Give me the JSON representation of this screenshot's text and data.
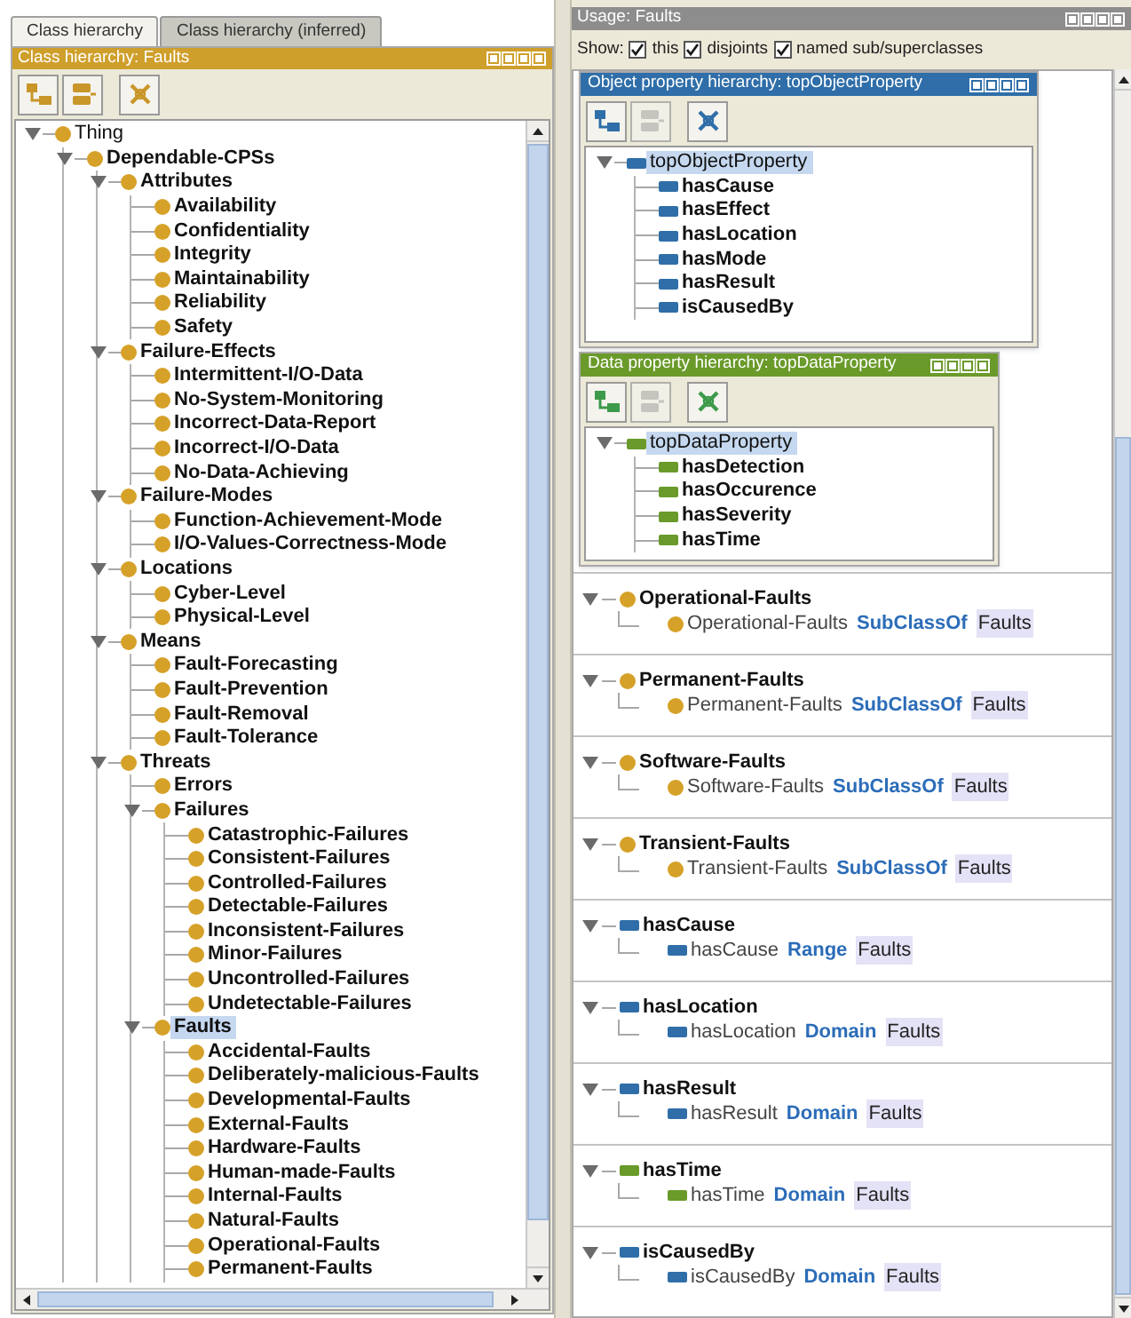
{
  "tabs": [
    {
      "label": "Class hierarchy",
      "selected": true
    },
    {
      "label": "Class hierarchy (inferred)",
      "selected": false
    }
  ],
  "class_hierarchy": {
    "title": "Class hierarchy: Faults",
    "toolbar": [
      {
        "kind": "add-sub",
        "disabled": false
      },
      {
        "kind": "add-sibling",
        "disabled": false
      },
      {
        "kind": "delete",
        "disabled": false
      }
    ],
    "tree": [
      {
        "label": "Thing",
        "expanded": true,
        "selected": false,
        "children": [
          {
            "label": "Dependable-CPSs",
            "expanded": true,
            "selected": false,
            "children": [
              {
                "label": "Attributes",
                "expanded": true,
                "selected": false,
                "children": [
                  {
                    "label": "Availability",
                    "selected": false
                  },
                  {
                    "label": "Confidentiality",
                    "selected": false
                  },
                  {
                    "label": "Integrity",
                    "selected": false
                  },
                  {
                    "label": "Maintainability",
                    "selected": false
                  },
                  {
                    "label": "Reliability",
                    "selected": false
                  },
                  {
                    "label": "Safety",
                    "selected": false
                  }
                ]
              },
              {
                "label": "Failure-Effects",
                "expanded": true,
                "selected": false,
                "children": [
                  {
                    "label": "Intermittent-I/O-Data",
                    "selected": false
                  },
                  {
                    "label": "No-System-Monitoring",
                    "selected": false
                  },
                  {
                    "label": "Incorrect-Data-Report",
                    "selected": false
                  },
                  {
                    "label": "Incorrect-I/O-Data",
                    "selected": false
                  },
                  {
                    "label": "No-Data-Achieving",
                    "selected": false
                  }
                ]
              },
              {
                "label": "Failure-Modes",
                "expanded": true,
                "selected": false,
                "children": [
                  {
                    "label": "Function-Achievement-Mode",
                    "selected": false
                  },
                  {
                    "label": "I/O-Values-Correctness-Mode",
                    "selected": false
                  }
                ]
              },
              {
                "label": "Locations",
                "expanded": true,
                "selected": false,
                "children": [
                  {
                    "label": "Cyber-Level",
                    "selected": false
                  },
                  {
                    "label": "Physical-Level",
                    "selected": false
                  }
                ]
              },
              {
                "label": "Means",
                "expanded": true,
                "selected": false,
                "children": [
                  {
                    "label": "Fault-Forecasting",
                    "selected": false
                  },
                  {
                    "label": "Fault-Prevention",
                    "selected": false
                  },
                  {
                    "label": "Fault-Removal",
                    "selected": false
                  },
                  {
                    "label": "Fault-Tolerance",
                    "selected": false
                  }
                ]
              },
              {
                "label": "Threats",
                "expanded": true,
                "selected": false,
                "children": [
                  {
                    "label": "Errors",
                    "selected": false
                  },
                  {
                    "label": "Failures",
                    "expanded": true,
                    "selected": false,
                    "children": [
                      {
                        "label": "Catastrophic-Failures",
                        "selected": false
                      },
                      {
                        "label": "Consistent-Failures",
                        "selected": false
                      },
                      {
                        "label": "Controlled-Failures",
                        "selected": false
                      },
                      {
                        "label": "Detectable-Failures",
                        "selected": false
                      },
                      {
                        "label": "Inconsistent-Failures",
                        "selected": false
                      },
                      {
                        "label": "Minor-Failures",
                        "selected": false
                      },
                      {
                        "label": "Uncontrolled-Failures",
                        "selected": false
                      },
                      {
                        "label": "Undetectable-Failures",
                        "selected": false
                      }
                    ]
                  },
                  {
                    "label": "Faults",
                    "expanded": true,
                    "selected": true,
                    "children": [
                      {
                        "label": "Accidental-Faults",
                        "selected": false
                      },
                      {
                        "label": "Deliberately-malicious-Faults",
                        "selected": false
                      },
                      {
                        "label": "Developmental-Faults",
                        "selected": false
                      },
                      {
                        "label": "External-Faults",
                        "selected": false
                      },
                      {
                        "label": "Hardware-Faults",
                        "selected": false
                      },
                      {
                        "label": "Human-made-Faults",
                        "selected": false
                      },
                      {
                        "label": "Internal-Faults",
                        "selected": false
                      },
                      {
                        "label": "Natural-Faults",
                        "selected": false
                      },
                      {
                        "label": "Operational-Faults",
                        "selected": false
                      },
                      {
                        "label": "Permanent-Faults",
                        "selected": false
                      }
                    ]
                  }
                ]
              }
            ]
          }
        ]
      }
    ]
  },
  "usage": {
    "title": "Usage: Faults",
    "show_label": "Show:",
    "options": [
      {
        "label": "this",
        "checked": true
      },
      {
        "label": "disjoints",
        "checked": true
      },
      {
        "label": "named sub/superclasses",
        "checked": true
      }
    ],
    "entries": [
      {
        "kind": "class",
        "name": "Operational-Faults",
        "expanded": true,
        "axiom": {
          "subject": "Operational-Faults",
          "keyword": "SubClassOf",
          "target": "Faults"
        }
      },
      {
        "kind": "class",
        "name": "Permanent-Faults",
        "expanded": true,
        "axiom": {
          "subject": "Permanent-Faults",
          "keyword": "SubClassOf",
          "target": "Faults"
        }
      },
      {
        "kind": "class",
        "name": "Software-Faults",
        "expanded": true,
        "axiom": {
          "subject": "Software-Faults",
          "keyword": "SubClassOf",
          "target": "Faults"
        }
      },
      {
        "kind": "class",
        "name": "Transient-Faults",
        "expanded": true,
        "axiom": {
          "subject": "Transient-Faults",
          "keyword": "SubClassOf",
          "target": "Faults"
        }
      },
      {
        "kind": "object-property",
        "name": "hasCause",
        "expanded": true,
        "axiom": {
          "subject": "hasCause",
          "keyword": "Range",
          "target": "Faults"
        }
      },
      {
        "kind": "object-property",
        "name": "hasLocation",
        "expanded": true,
        "axiom": {
          "subject": "hasLocation",
          "keyword": "Domain",
          "target": "Faults"
        }
      },
      {
        "kind": "object-property",
        "name": "hasResult",
        "expanded": true,
        "axiom": {
          "subject": "hasResult",
          "keyword": "Domain",
          "target": "Faults"
        }
      },
      {
        "kind": "data-property",
        "name": "hasTime",
        "expanded": true,
        "axiom": {
          "subject": "hasTime",
          "keyword": "Domain",
          "target": "Faults"
        }
      },
      {
        "kind": "object-property",
        "name": "isCausedBy",
        "expanded": true,
        "axiom": {
          "subject": "isCausedBy",
          "keyword": "Domain",
          "target": "Faults"
        }
      }
    ]
  },
  "object_property_hierarchy": {
    "title": "Object property hierarchy: topObjectProperty",
    "toolbar": [
      {
        "kind": "add-sub",
        "disabled": false
      },
      {
        "kind": "add-sibling",
        "disabled": true
      },
      {
        "kind": "delete",
        "disabled": false
      }
    ],
    "tree": [
      {
        "label": "topObjectProperty",
        "expanded": true,
        "selected": true,
        "children": [
          {
            "label": "hasCause",
            "selected": false
          },
          {
            "label": "hasEffect",
            "selected": false
          },
          {
            "label": "hasLocation",
            "selected": false
          },
          {
            "label": "hasMode",
            "selected": false
          },
          {
            "label": "hasResult",
            "selected": false
          },
          {
            "label": "isCausedBy",
            "selected": false
          }
        ]
      }
    ]
  },
  "data_property_hierarchy": {
    "title": "Data property hierarchy: topDataProperty",
    "toolbar": [
      {
        "kind": "add-sub",
        "disabled": false
      },
      {
        "kind": "add-sibling",
        "disabled": true
      },
      {
        "kind": "delete",
        "disabled": false
      }
    ],
    "tree": [
      {
        "label": "topDataProperty",
        "expanded": true,
        "selected": true,
        "children": [
          {
            "label": "hasDetection",
            "selected": false
          },
          {
            "label": "hasOccurence",
            "selected": false
          },
          {
            "label": "hasSeverity",
            "selected": false
          },
          {
            "label": "hasTime",
            "selected": false
          }
        ]
      }
    ]
  }
}
